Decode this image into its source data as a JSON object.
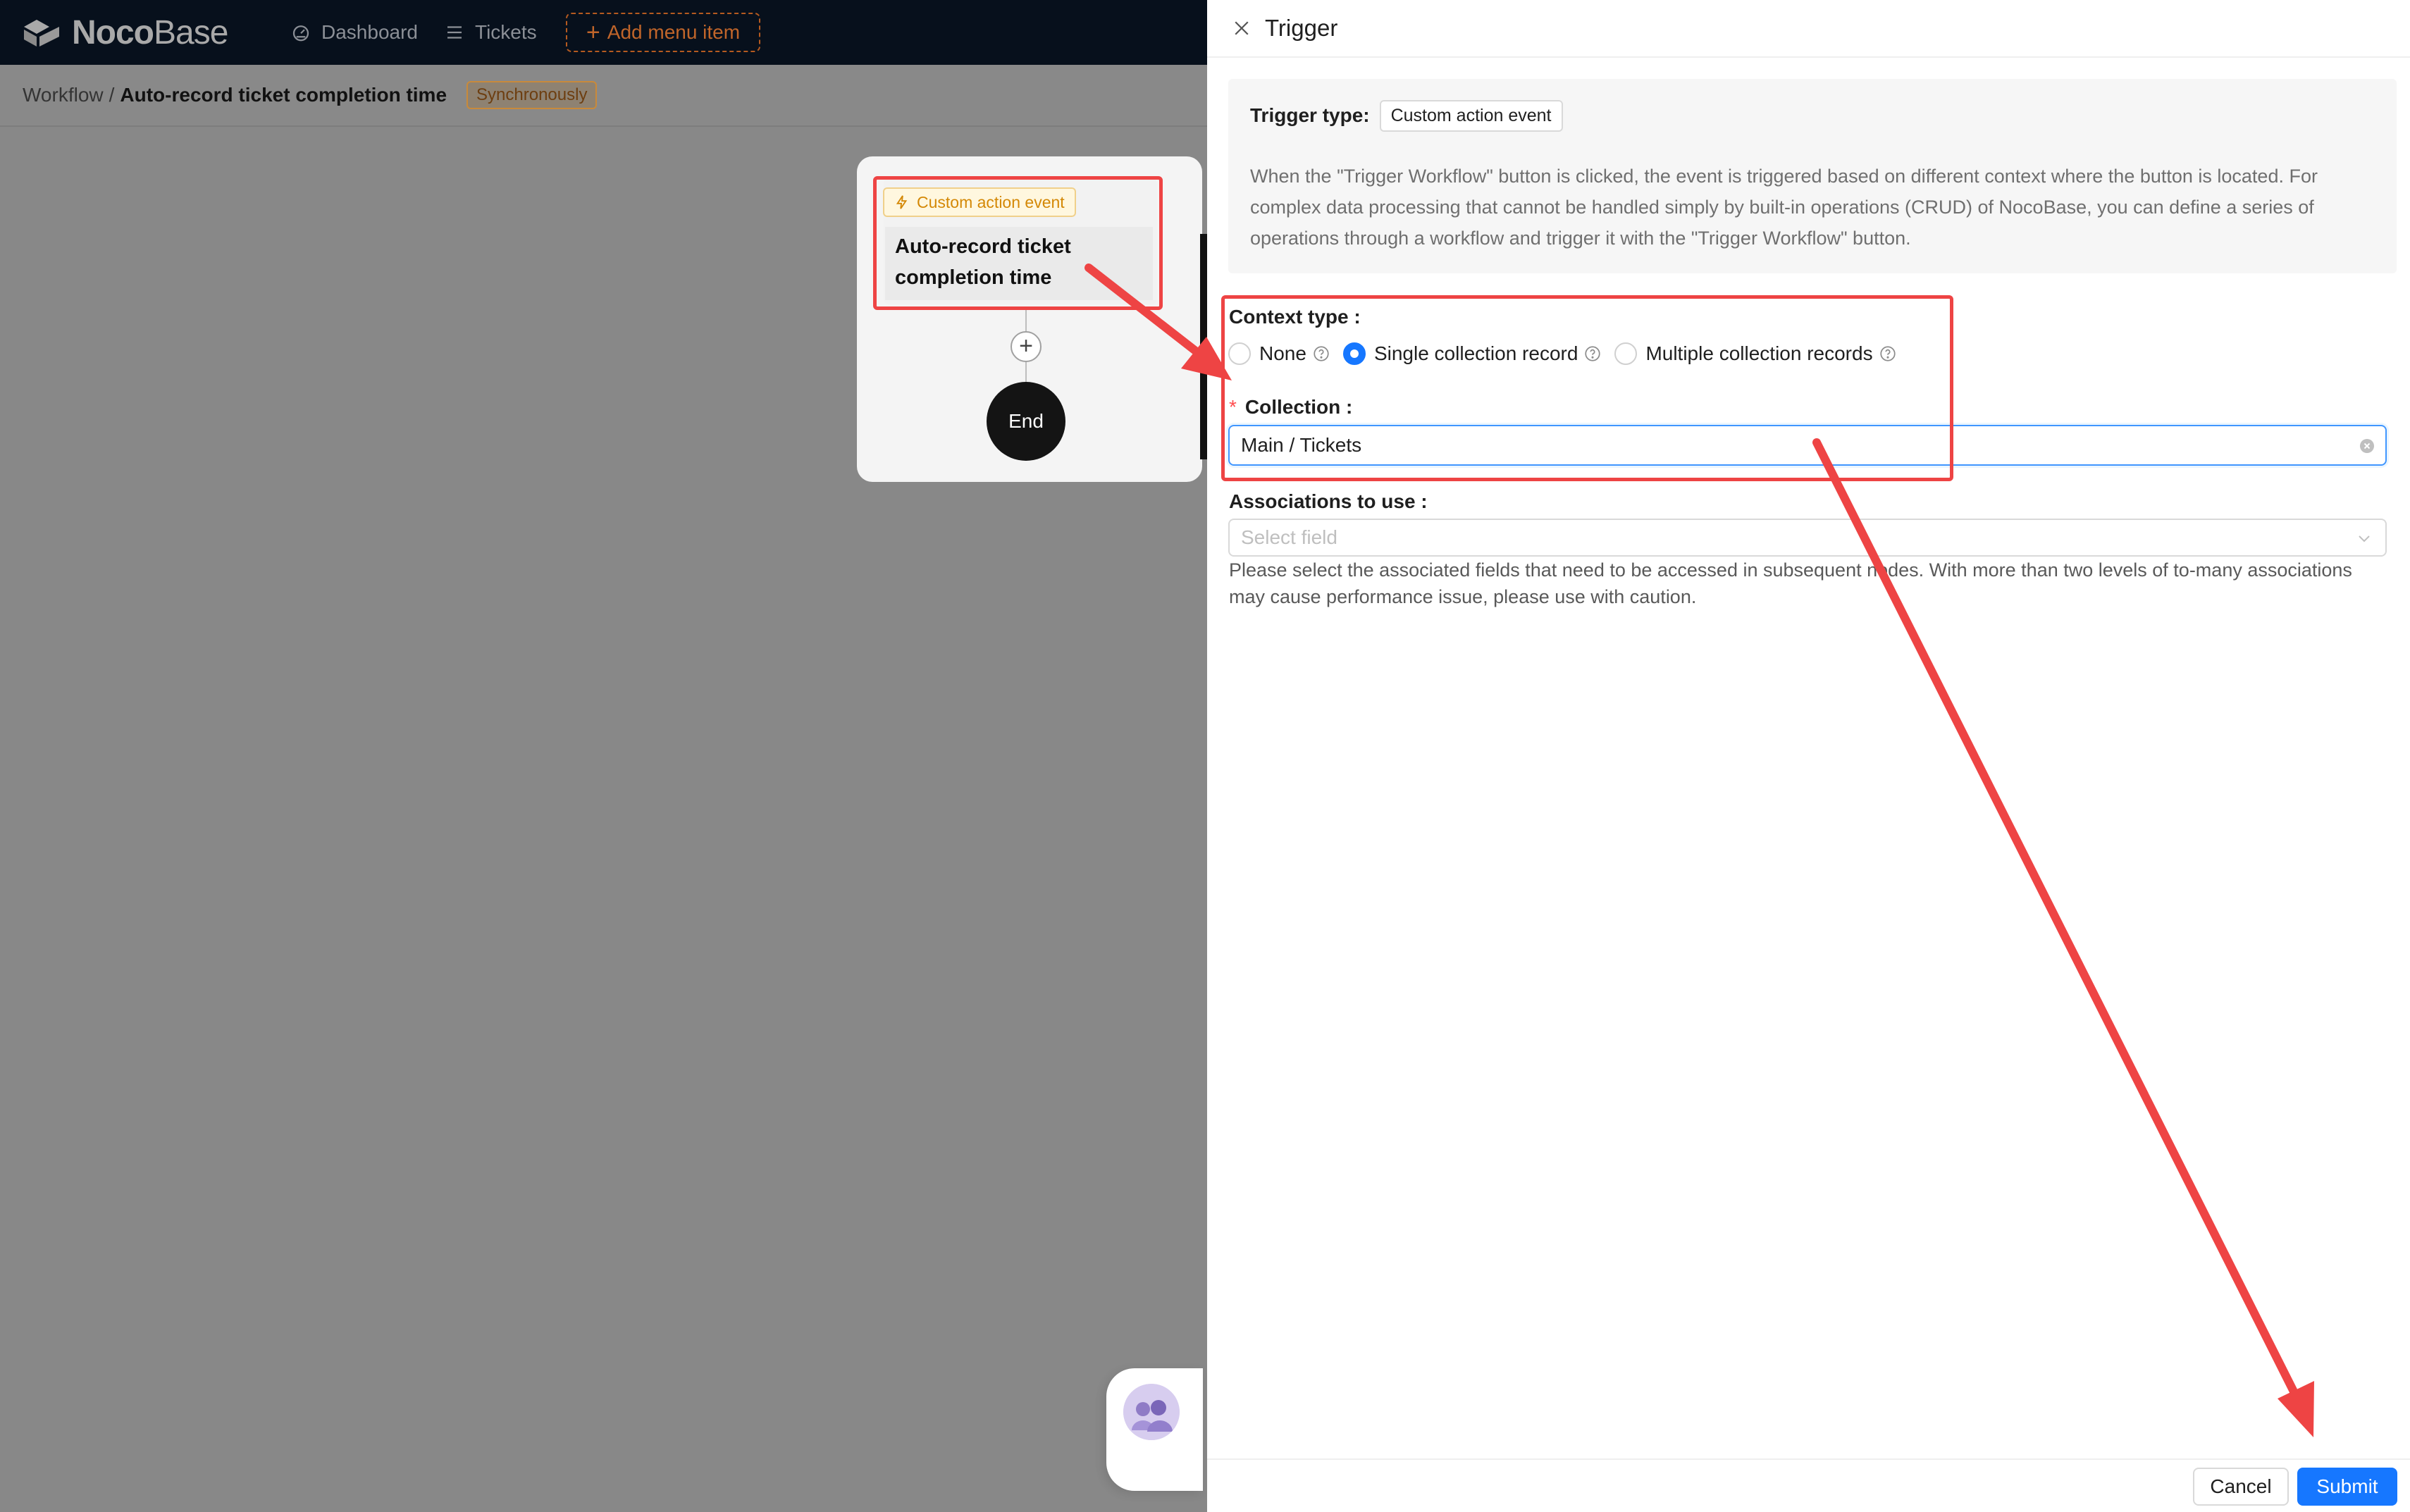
{
  "app": {
    "logo_bold": "Noco",
    "logo_light": "Base",
    "nav": {
      "dashboard": "Dashboard",
      "tickets": "Tickets",
      "add_menu_item": "Add menu item"
    }
  },
  "breadcrumb": {
    "root": "Workflow",
    "separator": "/",
    "current": "Auto-record ticket completion time",
    "badge": "Synchronously"
  },
  "workflow": {
    "trigger_tag": "Custom action event",
    "trigger_title": "Auto-record ticket completion time",
    "add_symbol": "+",
    "end_label": "End"
  },
  "drawer": {
    "title": "Trigger",
    "trigger_type_label": "Trigger type:",
    "trigger_type_value": "Custom action event",
    "description": "When the \"Trigger Workflow\" button is clicked, the event is triggered based on different context where the button is located. For complex data processing that cannot be handled simply by built-in operations (CRUD) of NocoBase, you can define a series of operations through a workflow and trigger it with the \"Trigger Workflow\" button.",
    "context_type": {
      "label": "Context type",
      "options": [
        {
          "label": "None",
          "checked": false
        },
        {
          "label": "Single collection record",
          "checked": true
        },
        {
          "label": "Multiple collection records",
          "checked": false
        }
      ]
    },
    "collection": {
      "required_mark": "*",
      "label": "Collection",
      "value": "Main / Tickets"
    },
    "associations": {
      "label": "Associations to use",
      "placeholder": "Select field",
      "help": "Please select the associated fields that need to be accessed in subsequent nodes. With more than two levels of to-many associations may cause performance issue, please use with caution."
    },
    "footer": {
      "cancel": "Cancel",
      "submit": "Submit"
    }
  },
  "colors": {
    "primary": "#1677ff",
    "annotation": "#ee4444",
    "trigger_tag": "#d48806"
  }
}
